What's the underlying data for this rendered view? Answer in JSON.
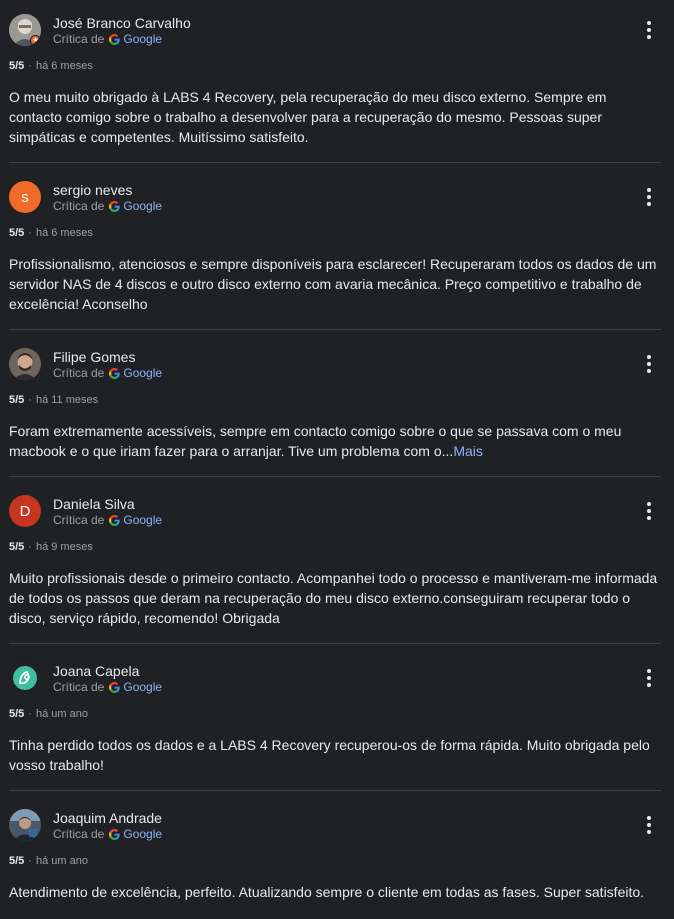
{
  "colors": {
    "background": "#202124",
    "text": "#e8eaed",
    "secondary_text": "#9aa0a6",
    "link": "#8ab4f8",
    "divider": "#3c4043"
  },
  "reviews": [
    {
      "author": "José Branco Carvalho",
      "source_label": "Crítica de",
      "source_name": "Google",
      "rating": "5/5",
      "separator": "·",
      "time": "há 6 meses",
      "text": "O meu muito obrigado à LABS 4 Recovery, pela recuperação do meu disco externo. Sempre em contacto comigo sobre o trabalho a desenvolver para a recuperação do mesmo. Pessoas super simpáticas e competentes. Muitíssimo satisfeito.",
      "more": "",
      "avatar": {
        "type": "photo",
        "icon": "person-photo-icon",
        "badge": "local-guide-badge-icon"
      }
    },
    {
      "author": "sergio neves",
      "source_label": "Crítica de",
      "source_name": "Google",
      "rating": "5/5",
      "separator": "·",
      "time": "há 6 meses",
      "text": "Profissionalismo, atenciosos e sempre disponíveis para esclarecer! Recuperaram todos os dados de um servidor NAS de 4 discos e outro disco externo com avaria mecânica. Preço competitivo e trabalho de excelência! Aconselho",
      "more": "",
      "avatar": {
        "type": "letter",
        "letter": "s",
        "color": "#f06a2a"
      }
    },
    {
      "author": "Filipe Gomes",
      "source_label": "Crítica de",
      "source_name": "Google",
      "rating": "5/5",
      "separator": "·",
      "time": "há 11 meses",
      "text": "Foram extremamente acessíveis, sempre em contacto comigo sobre o que se passava com o meu macbook e o que iriam fazer para o arranjar. Tive um problema com o...",
      "more": "Mais",
      "avatar": {
        "type": "photo",
        "icon": "person-photo-icon"
      }
    },
    {
      "author": "Daniela Silva",
      "source_label": "Crítica de",
      "source_name": "Google",
      "rating": "5/5",
      "separator": "·",
      "time": "há 9 meses",
      "text": "Muito profissionais desde o primeiro contacto. Acompanhei todo o processo e mantiveram-me informada de todos os passos que deram na recuperação do meu disco externo.conseguiram recuperar todo o disco, serviço rápido, recomendo! Obrigada",
      "more": "",
      "avatar": {
        "type": "letter",
        "letter": "D",
        "color": "#c5351f"
      }
    },
    {
      "author": "Joana Capela",
      "source_label": "Crítica de",
      "source_name": "Google",
      "rating": "5/5",
      "separator": "·",
      "time": "há um ano",
      "text": "Tinha perdido todos os dados e a LABS 4 Recovery recuperou-os de forma rápida. Muito obrigada pelo vosso trabalho!",
      "more": "",
      "avatar": {
        "type": "logo",
        "icon": "leaf-logo-icon",
        "color": "#3fbf9f"
      }
    },
    {
      "author": "Joaquim Andrade",
      "source_label": "Crítica de",
      "source_name": "Google",
      "rating": "5/5",
      "separator": "·",
      "time": "há um ano",
      "text": "Atendimento de excelência, perfeito. Atualizando sempre o cliente em todas as fases. Super satisfeito.",
      "more": "",
      "avatar": {
        "type": "photo",
        "icon": "person-photo-icon"
      }
    }
  ]
}
